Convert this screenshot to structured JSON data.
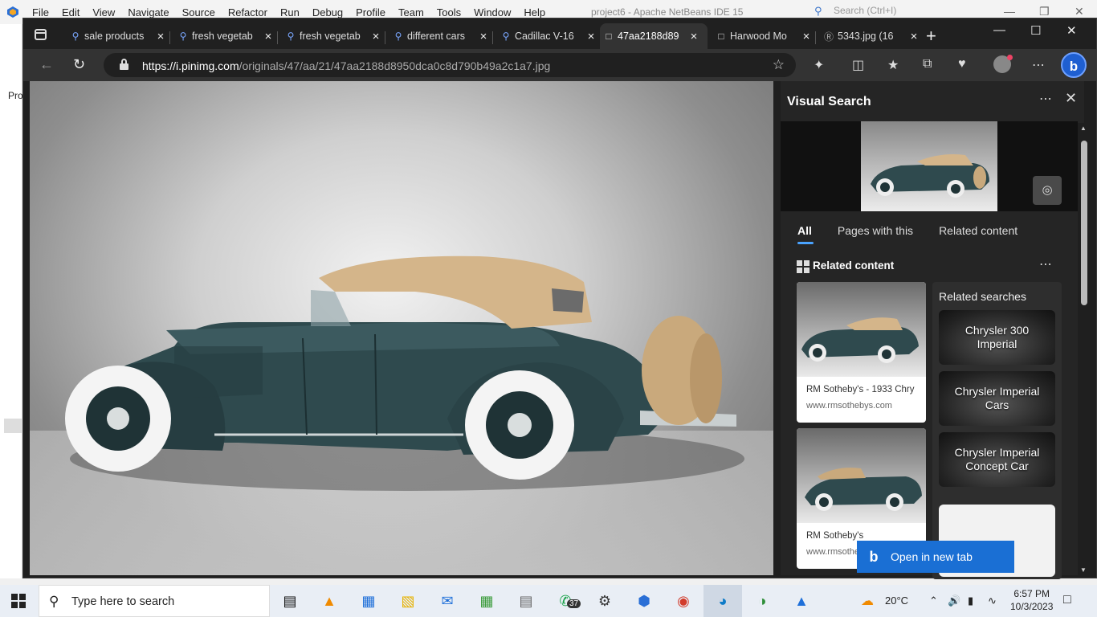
{
  "netbeans": {
    "menus": [
      "File",
      "Edit",
      "View",
      "Navigate",
      "Source",
      "Refactor",
      "Run",
      "Debug",
      "Profile",
      "Team",
      "Tools",
      "Window",
      "Help"
    ],
    "title": "project6 - Apache NetBeans IDE 15",
    "search_placeholder": "Search (Ctrl+I)",
    "projects_label": "Pro"
  },
  "browser": {
    "tabs": [
      {
        "label": "sale products"
      },
      {
        "label": "fresh vegetab"
      },
      {
        "label": "fresh vegetab"
      },
      {
        "label": "different cars"
      },
      {
        "label": "Cadillac V-16"
      },
      {
        "label": "47aa2188d89"
      },
      {
        "label": "Harwood Mo"
      },
      {
        "label": "5343.jpg (16"
      }
    ],
    "active_tab_index": 5,
    "url_host": "https://i.pinimg.com",
    "url_path": "/originals/47/aa/21/47aa2188d8950dca0c8d790b49a2c1a7.jpg"
  },
  "visual_search": {
    "title": "Visual Search",
    "tabs": [
      "All",
      "Pages with this",
      "Related content"
    ],
    "active_tab": "All",
    "related_content_heading": "Related content",
    "cards": [
      {
        "title": "RM Sotheby's - 1933 Chry",
        "site": "www.rmsothebys.com"
      },
      {
        "title": "RM Sotheby's",
        "site": "www.rmsothebys.com"
      }
    ],
    "related_searches_heading": "Related searches",
    "related_searches": [
      "Chrysler 300 Imperial",
      "Chrysler Imperial Cars",
      "Chrysler Imperial Concept Car"
    ],
    "open_new_tab": "Open in new tab"
  },
  "taskbar": {
    "search_placeholder": "Type here to search",
    "whatsapp_badge": "37",
    "temperature": "20°C",
    "time": "6:57 PM",
    "date": "10/3/2023"
  },
  "colors": {
    "accent": "#1a6fd4",
    "browser_bg": "#1f1f1f",
    "car_body": "#2f4a4e",
    "soft_top": "#d4b58a"
  }
}
